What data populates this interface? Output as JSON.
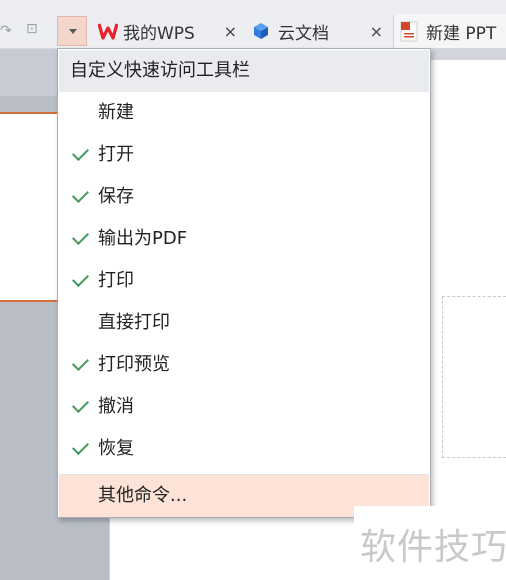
{
  "tabs": [
    {
      "label": "我的WPS",
      "close": "×"
    },
    {
      "label": "云文档",
      "close": "×"
    },
    {
      "label": "新建 PPT"
    }
  ],
  "menu": {
    "title": "自定义快速访问工具栏",
    "items": [
      {
        "label": "新建",
        "checked": false
      },
      {
        "label": "打开",
        "checked": true
      },
      {
        "label": "保存",
        "checked": true
      },
      {
        "label": "输出为PDF",
        "checked": true
      },
      {
        "label": "打印",
        "checked": true
      },
      {
        "label": "直接打印",
        "checked": false
      },
      {
        "label": "打印预览",
        "checked": true
      },
      {
        "label": "撤消",
        "checked": true
      },
      {
        "label": "恢复",
        "checked": true
      }
    ],
    "more_label": "其他命令..."
  },
  "watermark": "软件技巧",
  "colors": {
    "accent": "#d0703b",
    "check": "#3f9b5a",
    "hover": "#fde2d8",
    "wps_red": "#e8232c",
    "cloud_blue": "#2f7de1"
  }
}
